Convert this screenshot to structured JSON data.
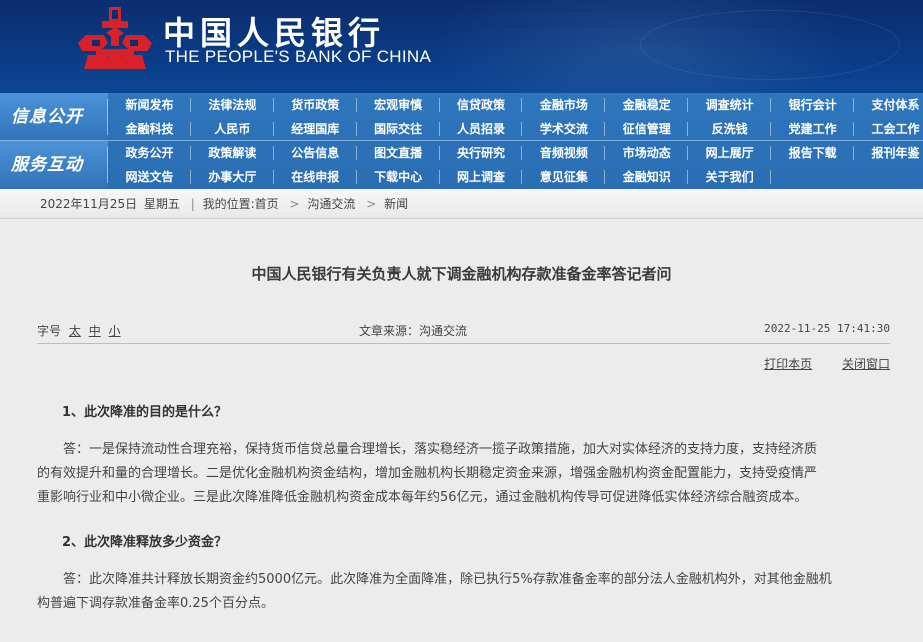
{
  "header": {
    "bank_cn": "中国人民银行",
    "bank_en": "THE PEOPLE'S BANK OF CHINA",
    "logo_icon": "pboc-logo-icon",
    "brand_red": "#d9212a"
  },
  "nav": {
    "sections": [
      {
        "title": "信息公开",
        "rows": [
          [
            "新闻发布",
            "法律法规",
            "货币政策",
            "宏观审慎",
            "信贷政策",
            "金融市场",
            "金融稳定",
            "调查统计",
            "银行会计",
            "支付体系"
          ],
          [
            "金融科技",
            "人民币",
            "经理国库",
            "国际交往",
            "人员招录",
            "学术交流",
            "征信管理",
            "反洗钱",
            "党建工作",
            "工会工作"
          ]
        ]
      },
      {
        "title": "服务互动",
        "rows": [
          [
            "政务公开",
            "政策解读",
            "公告信息",
            "图文直播",
            "央行研究",
            "音频视频",
            "市场动态",
            "网上展厅",
            "报告下载",
            "报刊年鉴"
          ],
          [
            "网送文告",
            "办事大厅",
            "在线申报",
            "下载中心",
            "网上调查",
            "意见征集",
            "金融知识",
            "关于我们"
          ]
        ]
      }
    ]
  },
  "breadcrumb": {
    "date": "2022年11月25日",
    "weekday": "星期五",
    "location_label": "我的位置:首页",
    "path": [
      "沟通交流",
      "新闻"
    ]
  },
  "article": {
    "title": "中国人民银行有关负责人就下调金融机构存款准备金率答记者问",
    "font_size_label": "字号",
    "font_sizes": [
      "太",
      "中",
      "小"
    ],
    "source": "文章来源：沟通交流",
    "datetime": "2022-11-25 17:41:30",
    "print_label": "打印本页",
    "close_label": "关闭窗口",
    "q1": "1、此次降准的目的是什么？",
    "a1_lines": [
      "答：一是保持流动性合理充裕，保持货币信贷总量合理增长，落实稳经济一揽子政策措施，加大对实体经济的支持力度，支持经济质",
      "的有效提升和量的合理增长。二是优化金融机构资金结构，增加金融机构长期稳定资金来源，增强金融机构资金配置能力，支持受疫情严",
      "重影响行业和中小微企业。三是此次降准降低金融机构资金成本每年约56亿元，通过金融机构传导可促进降低实体经济综合融资成本。"
    ],
    "q2": "2、此次降准释放多少资金？",
    "a2_lines": [
      "答：此次降准共计释放长期资金约5000亿元。此次降准为全面降准，除已执行5%存款准备金率的部分法人金融机构外，对其他金融机",
      "构普遍下调存款准备金率0.25个百分点。"
    ]
  }
}
